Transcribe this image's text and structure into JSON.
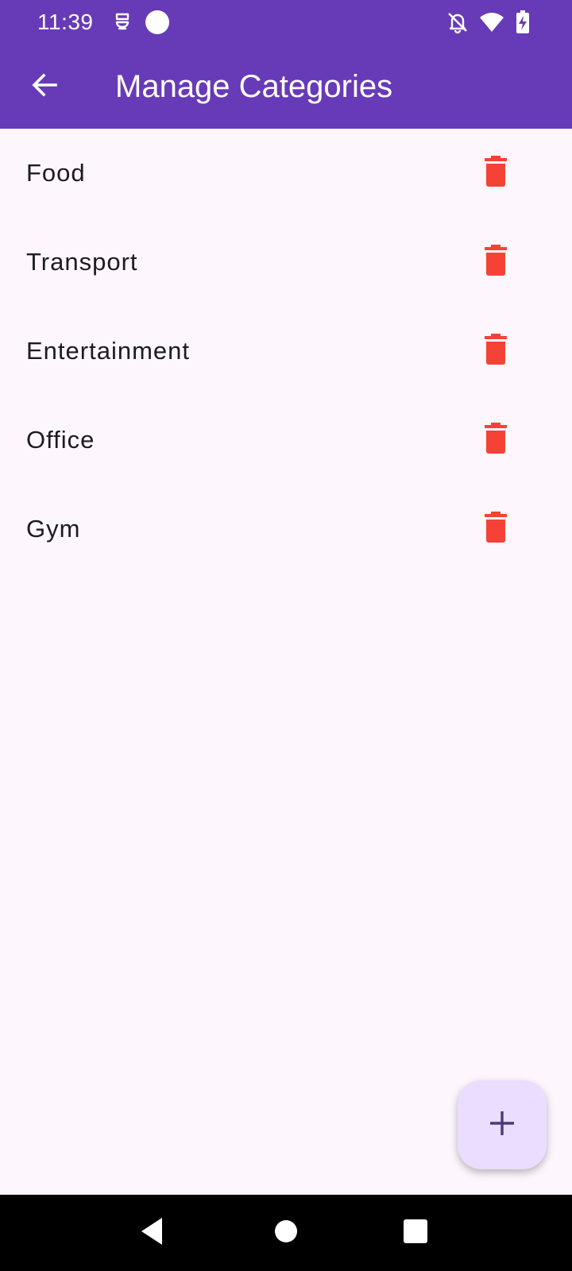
{
  "status_bar": {
    "time": "11:39",
    "icons": [
      "status-app-icon",
      "status-dot-icon",
      "notifications-off-icon",
      "wifi-icon",
      "battery-charging-icon"
    ]
  },
  "app_bar": {
    "title": "Manage Categories",
    "back_icon": "arrow-back-icon",
    "background_color": "#673AB7"
  },
  "categories": [
    {
      "label": "Food"
    },
    {
      "label": "Transport"
    },
    {
      "label": "Entertainment"
    },
    {
      "label": "Office"
    },
    {
      "label": "Gym"
    }
  ],
  "delete_icon": "trash-icon",
  "delete_color": "#F44336",
  "fab": {
    "icon": "plus-icon",
    "background_color": "#EADDFF"
  },
  "nav_bar": {
    "icons": [
      "nav-back-icon",
      "nav-home-icon",
      "nav-recents-icon"
    ]
  }
}
